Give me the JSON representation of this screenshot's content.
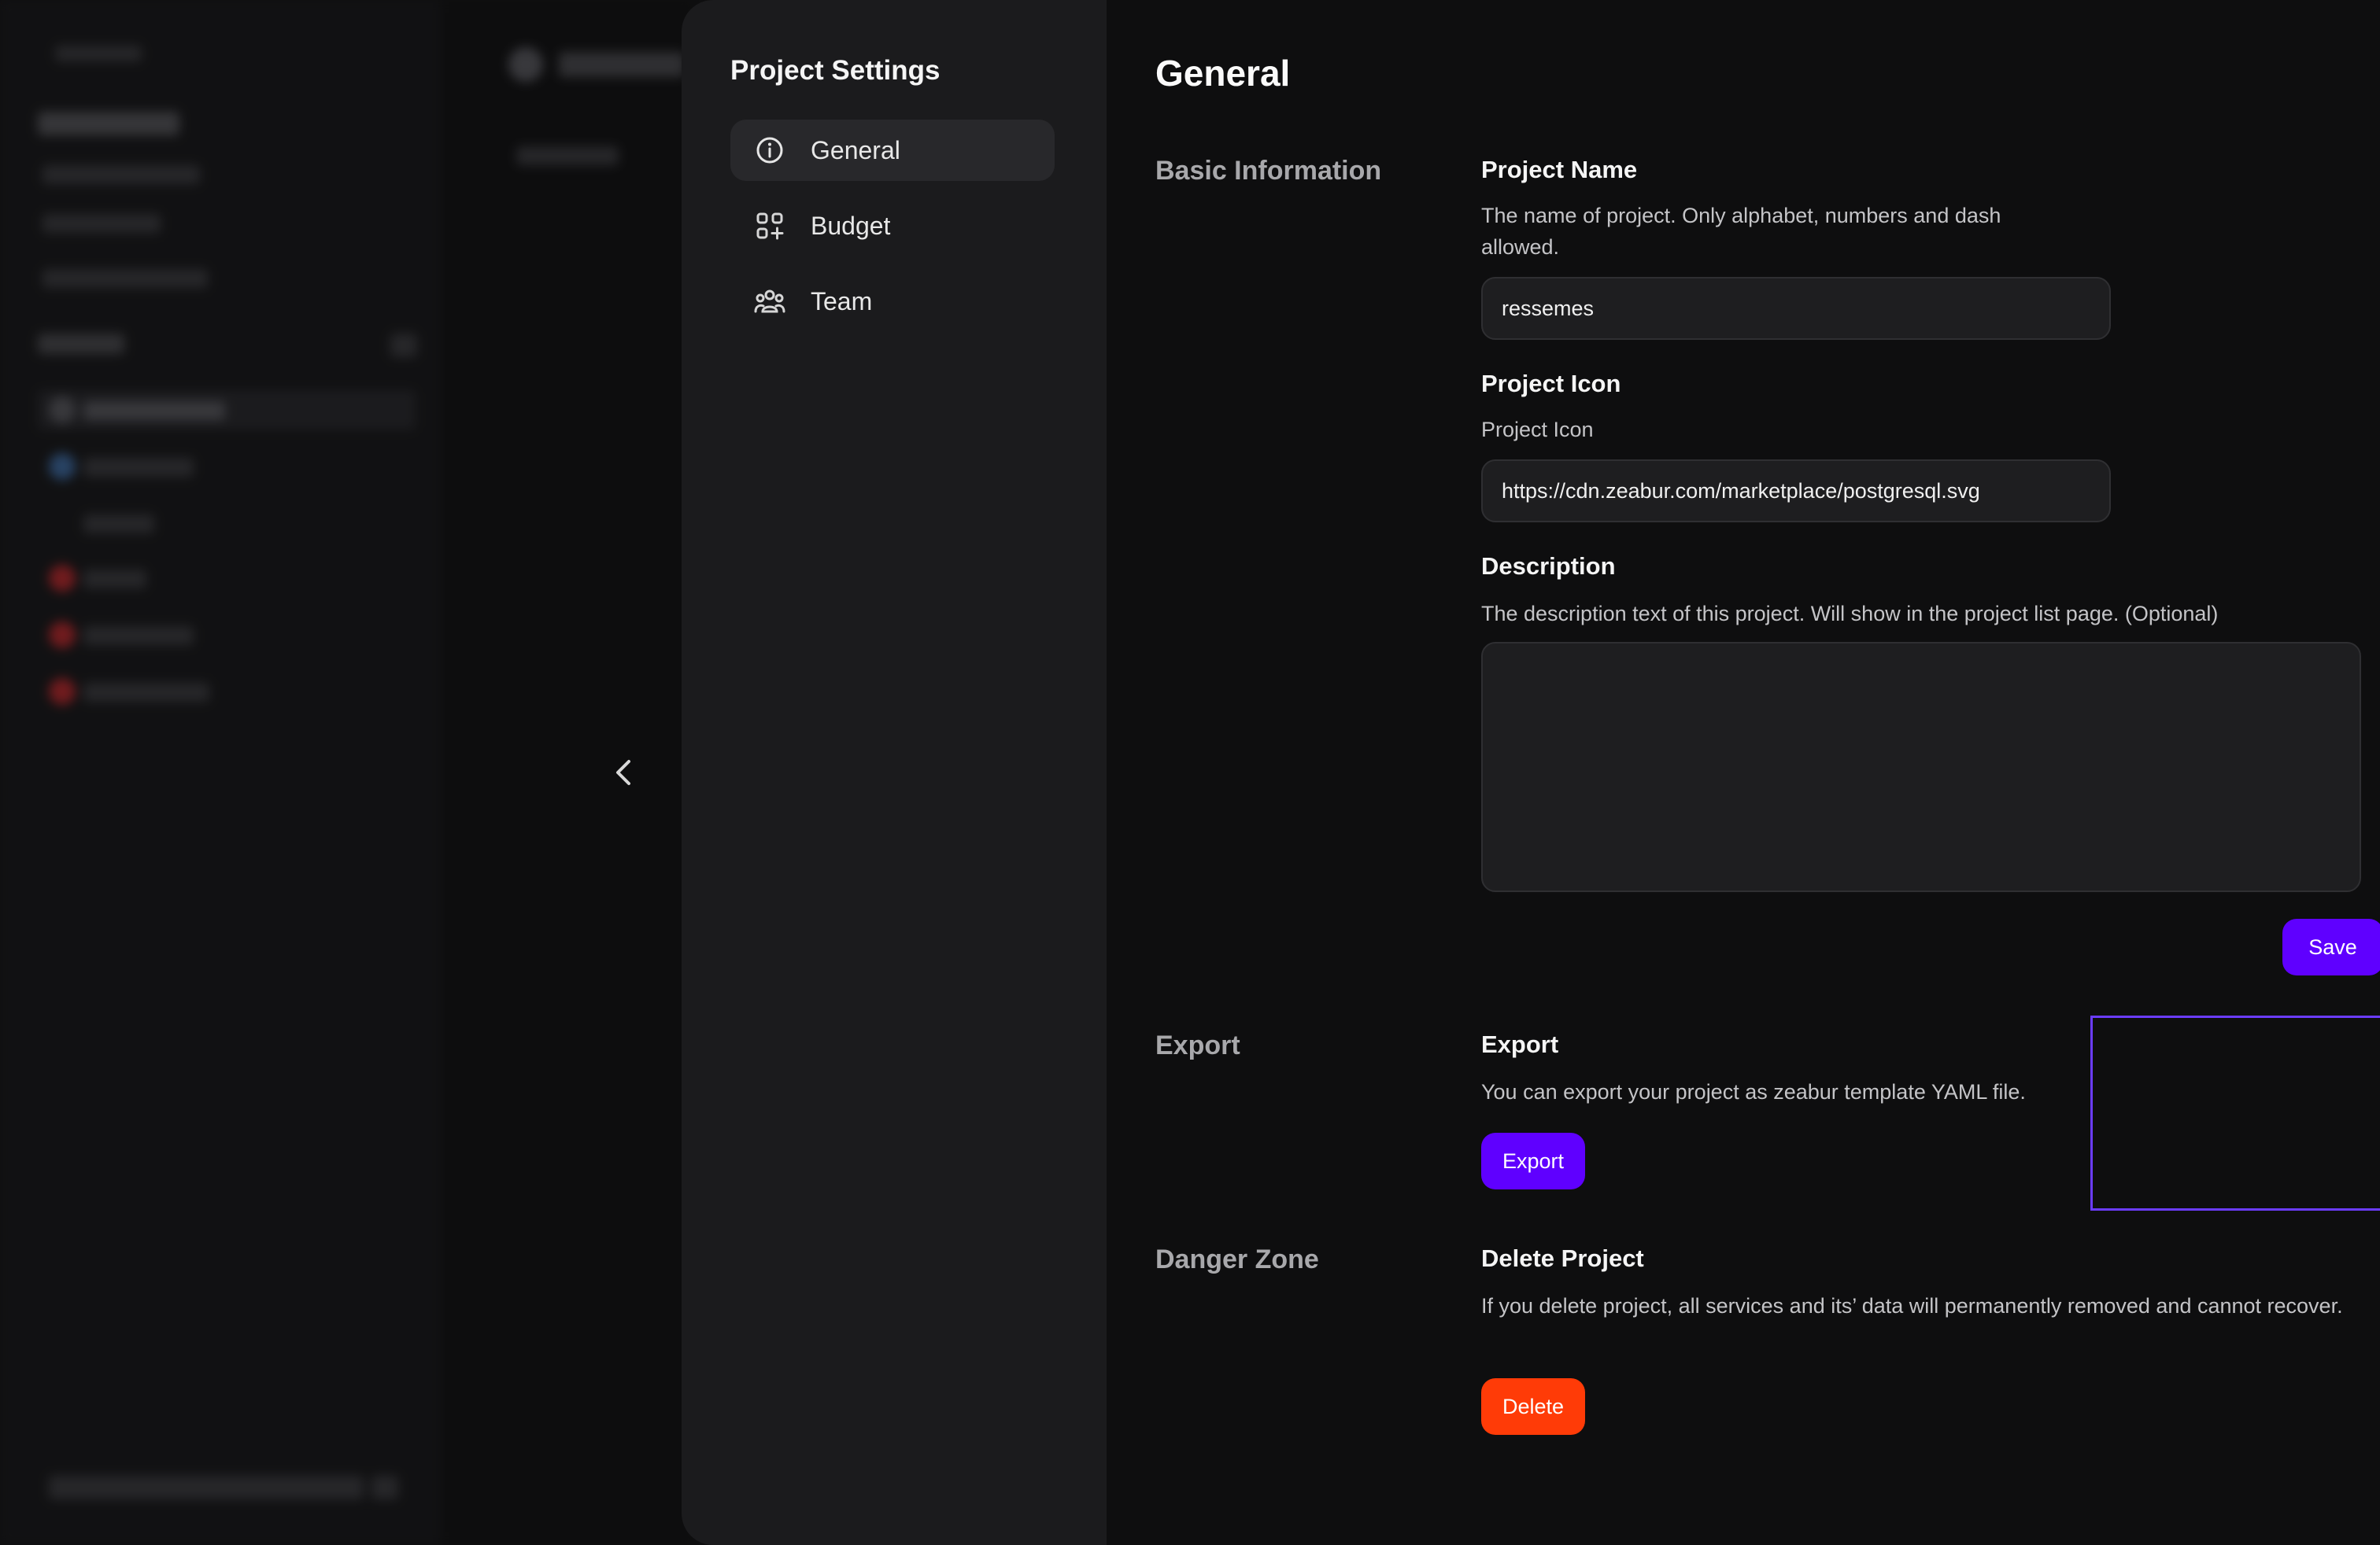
{
  "panel": {
    "title": "Project Settings",
    "nav": [
      {
        "label": "General",
        "icon": "info-icon",
        "active": true
      },
      {
        "label": "Budget",
        "icon": "budget-icon",
        "active": false
      },
      {
        "label": "Team",
        "icon": "team-icon",
        "active": false
      }
    ]
  },
  "page": {
    "title": "General",
    "sections": {
      "basic": "Basic Information",
      "export": "Export",
      "danger": "Danger Zone"
    }
  },
  "fields": {
    "project_name": {
      "label": "Project Name",
      "description": "The name of project. Only alphabet, numbers and dash allowed.",
      "value": "ressemes"
    },
    "project_icon": {
      "label": "Project Icon",
      "description": "Project Icon",
      "value": "https://cdn.zeabur.com/marketplace/postgresql.svg",
      "preview_icon": "postgresql-elephant-icon"
    },
    "description": {
      "label": "Description",
      "description": "The description text of this project. Will show in the project list page. (Optional)",
      "value": ""
    },
    "save_label": "Save"
  },
  "export": {
    "title": "Export",
    "description": "You can export your project as zeabur template YAML file.",
    "button": "Export"
  },
  "danger": {
    "title": "Delete Project",
    "description": "If you delete project, all services and its’ data will permanently removed and cannot recover.",
    "button": "Delete"
  },
  "colors": {
    "primary": "#5f00ff",
    "danger": "#ff3b07",
    "highlight_border": "#6b3cff",
    "postgres_blue": "#336791"
  }
}
